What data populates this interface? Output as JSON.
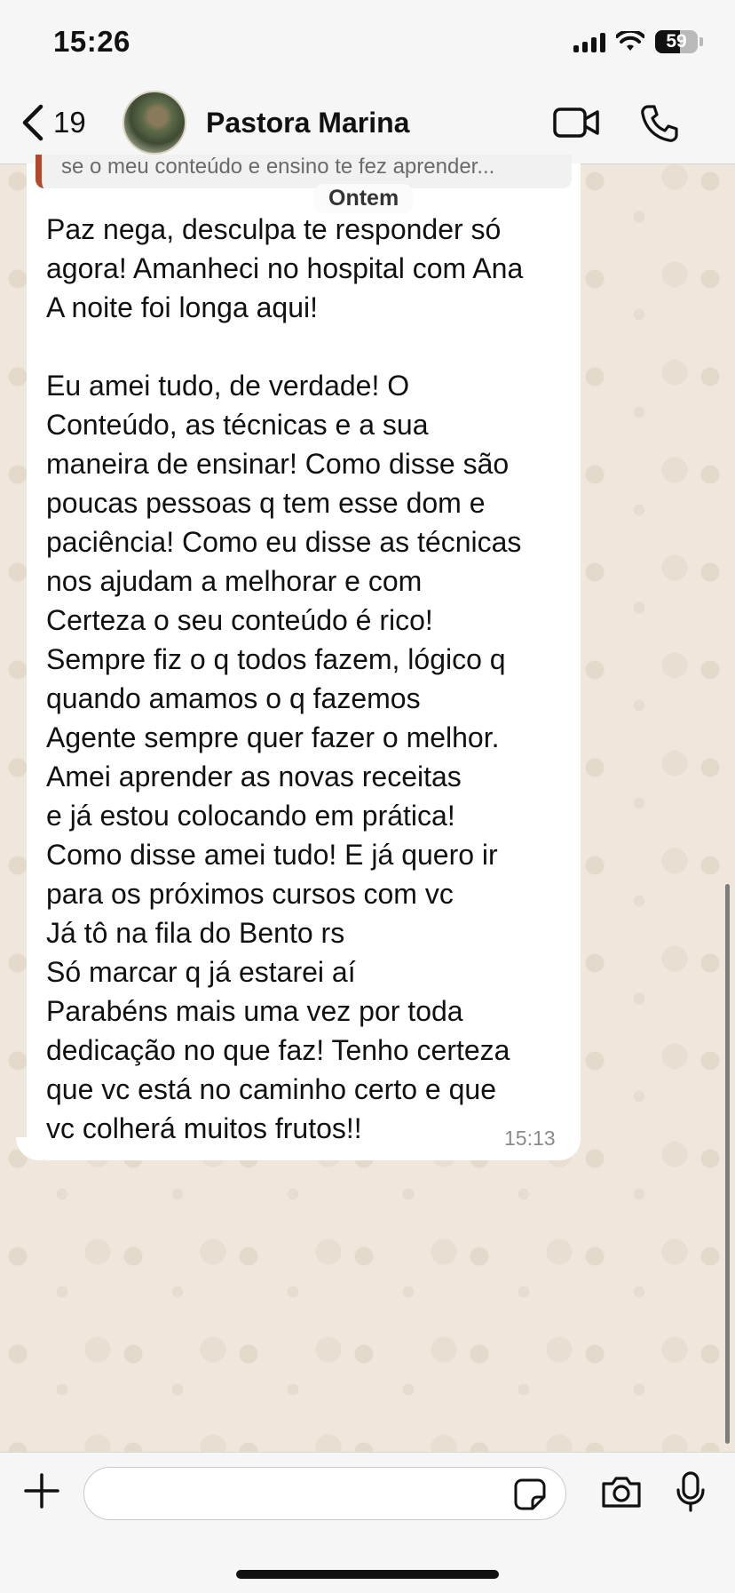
{
  "status_bar": {
    "time": "15:26",
    "signal_bars": 4,
    "battery_level": "59",
    "battery_percent": 59
  },
  "header": {
    "back_count": "19",
    "contact_name": "Pastora Marina",
    "icons": [
      "chevron-left-icon",
      "video-camera-icon",
      "phone-icon"
    ]
  },
  "conversation": {
    "quoted_reply": "se o meu conteúdo e ensino te fez aprender...",
    "quoted_accent_color": "#b24a2a",
    "date_separator": "Ontem",
    "message": {
      "text": "Paz nega, desculpa te responder só\nagora! Amanheci no hospital com Ana\nA noite foi longa aqui!\n\nEu amei tudo, de verdade! O\nConteúdo, as técnicas e a sua\nmaneira de ensinar! Como disse são\npoucas pessoas q tem esse dom e\npaciência! Como eu disse as técnicas\nnos ajudam a melhorar e com\nCerteza o seu conteúdo é rico!\nSempre fiz o q todos fazem, lógico q\nquando amamos o q fazemos\nAgente sempre quer fazer o melhor.\nAmei aprender as novas receitas\ne já estou colocando em prática!\nComo disse amei tudo! E já quero ir\npara os próximos cursos com vc\nJá tô na fila do Bento rs\nSó marcar q já estarei aí\nParabéns mais uma vez por toda\ndedicação no que faz! Tenho certeza\nque vc está no caminho certo e que\nvc colherá muitos frutos!!",
      "time": "15:13"
    }
  },
  "composer": {
    "input_value": "",
    "icons": [
      "plus-icon",
      "sticker-icon",
      "camera-icon",
      "microphone-icon"
    ]
  },
  "colors": {
    "wallpaper": "#efe7dc",
    "bar_background": "#f6f6f6",
    "bubble": "#ffffff"
  }
}
